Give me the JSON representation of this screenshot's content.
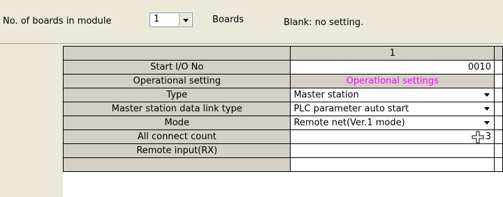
{
  "module": {
    "boards_label": "No. of boards in module",
    "boards_value": "1",
    "boards_unit": "Boards",
    "blank_note": "Blank: no setting."
  },
  "grid": {
    "column_header": "1",
    "rows": [
      {
        "label": "Start I/O No",
        "value": "0010"
      },
      {
        "label": "Operational setting",
        "value": "Operational settings"
      },
      {
        "label": "Type",
        "value": "Master station"
      },
      {
        "label": "Master station data link type",
        "value": "PLC parameter auto start"
      },
      {
        "label": "Mode",
        "value": "Remote net(Ver.1 mode)"
      },
      {
        "label": "All connect count",
        "value": "3"
      },
      {
        "label": "Remote input(RX)",
        "value": ""
      }
    ]
  },
  "colors": {
    "window_bg": "#ece9d8",
    "header_gray": "#d4d0c8",
    "link_text": "#ff00ff"
  },
  "icons": {
    "dropdown": "chevron-down-icon",
    "cursor": "move-cursor-icon"
  }
}
